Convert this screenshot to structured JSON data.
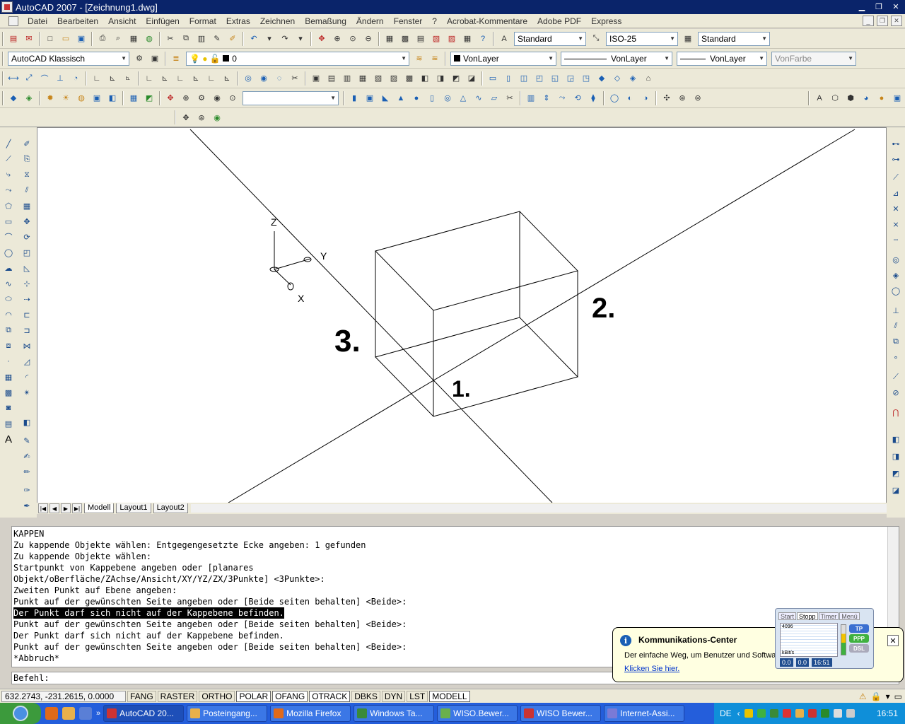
{
  "window": {
    "title": "AutoCAD 2007 - [Zeichnung1.dwg]"
  },
  "menu": [
    "Datei",
    "Bearbeiten",
    "Ansicht",
    "Einfügen",
    "Format",
    "Extras",
    "Zeichnen",
    "Bemaßung",
    "Ändern",
    "Fenster",
    "?",
    "Acrobat-Kommentare",
    "Adobe PDF",
    "Express"
  ],
  "toolbar_styles": {
    "text_style": "Standard",
    "dim_style": "ISO-25",
    "table_style": "Standard"
  },
  "toolbar_layers": {
    "workspace": "AutoCAD Klassisch",
    "layer": "0",
    "color": "VonLayer",
    "linetype": "VonLayer",
    "lineweight": "VonLayer",
    "plotstyle": "VonFarbe"
  },
  "drawing": {
    "ucs": {
      "z": "Z",
      "y": "Y",
      "x": "X"
    },
    "annotations": {
      "one": "1.",
      "two": "2.",
      "three": "3."
    }
  },
  "layout_tabs": [
    "Modell",
    "Layout1",
    "Layout2"
  ],
  "command_history": [
    "KAPPEN",
    "Zu kappende Objekte wählen: Entgegengesetzte Ecke angeben: 1 gefunden",
    "Zu kappende Objekte wählen:",
    "Startpunkt von Kappebene angeben oder [planares",
    "Objekt/oBerfläche/ZAchse/Ansicht/XY/YZ/ZX/3Punkte] <3Punkte>:",
    "Zweiten Punkt auf Ebene angeben:",
    "Punkt auf der gewünschten Seite angeben oder [Beide seiten behalten] <Beide>:",
    "Der Punkt darf sich nicht auf der Kappebene befinden.",
    "Punkt auf der gewünschten Seite angeben oder [Beide seiten behalten] <Beide>:",
    "Der Punkt darf sich nicht auf der Kappebene befinden.",
    "Punkt auf der gewünschten Seite angeben oder [Beide seiten behalten] <Beide>:",
    "*Abbruch*"
  ],
  "command_prompt": "Befehl:",
  "status": {
    "coords": "632.2743, -231.2615, 0.0000",
    "buttons": [
      "FANG",
      "RASTER",
      "ORTHO",
      "POLAR",
      "OFANG",
      "OTRACK",
      "DBKS",
      "DYN",
      "LST",
      "MODELL"
    ]
  },
  "balloon": {
    "title": "Kommunikations-Center",
    "text": "Der einfache Weg, um Benutzer und Software ... halten.",
    "link": "Klicken Sie hier."
  },
  "dsl_widget": {
    "tabs": [
      "Start",
      "Stopp",
      "Timer",
      "Menü"
    ],
    "graph_top": "4096",
    "graph_unit": "kBit/s",
    "down": "0.0",
    "up": "0.0",
    "time": "16:51",
    "badges": [
      "TP",
      "PPP",
      "DSL"
    ]
  },
  "taskbar": {
    "tasks": [
      "AutoCAD 20...",
      "Posteingang...",
      "Mozilla Firefox",
      "Windows Ta...",
      "WISO.Bewer...",
      "WISO Bewer...",
      "Internet-Assi..."
    ],
    "lang": "DE",
    "clock": "16:51"
  },
  "colors": {
    "titlebar": "#0a246a",
    "taskbar": "#245edb",
    "highlight": "#000000"
  }
}
